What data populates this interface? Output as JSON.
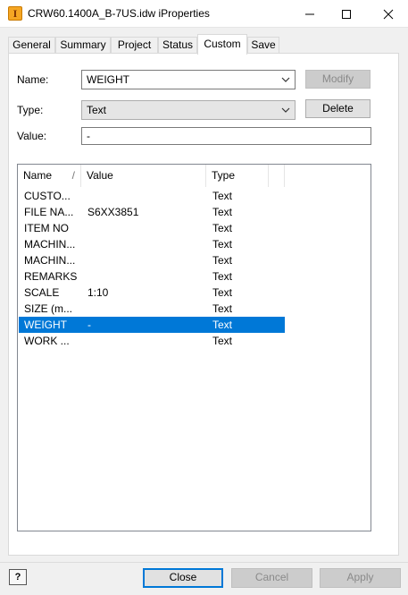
{
  "window": {
    "app_icon_letter": "I",
    "title": "CRW60.1400A_B-7US.idw iProperties"
  },
  "tabs": [
    {
      "label": "General"
    },
    {
      "label": "Summary"
    },
    {
      "label": "Project"
    },
    {
      "label": "Status"
    },
    {
      "label": "Custom",
      "active": true
    },
    {
      "label": "Save"
    }
  ],
  "form": {
    "name_label": "Name:",
    "name_value": "WEIGHT",
    "type_label": "Type:",
    "type_value": "Text",
    "value_label": "Value:",
    "value_value": "-",
    "modify_button": "Modify",
    "delete_button": "Delete"
  },
  "list": {
    "columns": [
      "Name",
      "Value",
      "Type"
    ],
    "rows": [
      {
        "name": "CUSTO...",
        "value": "",
        "type": "Text"
      },
      {
        "name": "FILE NA...",
        "value": "S6XX3851",
        "type": "Text"
      },
      {
        "name": "ITEM NO",
        "value": "",
        "type": "Text"
      },
      {
        "name": "MACHIN...",
        "value": "",
        "type": "Text"
      },
      {
        "name": "MACHIN...",
        "value": "",
        "type": "Text"
      },
      {
        "name": "REMARKS",
        "value": "",
        "type": "Text"
      },
      {
        "name": "SCALE",
        "value": "1:10",
        "type": "Text"
      },
      {
        "name": "SIZE (m...",
        "value": "",
        "type": "Text"
      },
      {
        "name": "WEIGHT",
        "value": "-",
        "type": "Text",
        "selected": true
      },
      {
        "name": "WORK ...",
        "value": "",
        "type": "Text"
      }
    ]
  },
  "footer": {
    "help_label": "?",
    "close_button": "Close",
    "cancel_button": "Cancel",
    "apply_button": "Apply"
  },
  "colors": {
    "selection": "#0078d7",
    "app_icon": "#f5a623"
  }
}
